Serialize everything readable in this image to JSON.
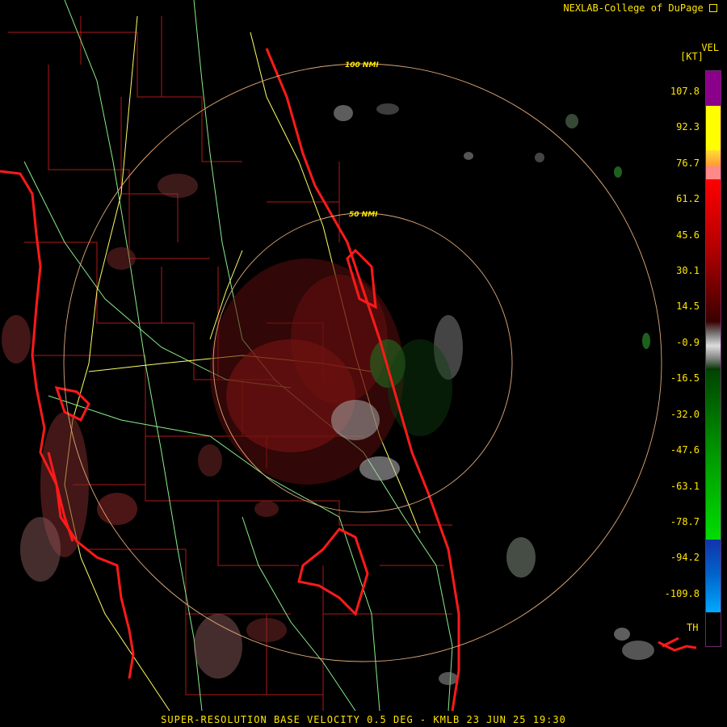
{
  "credit": "NEXLAB-College of DuPage",
  "scale": {
    "product": "VEL",
    "unit": "[KT]",
    "ticks": [
      "107.8",
      "92.3",
      "76.7",
      "61.2",
      "45.6",
      "30.1",
      "14.5",
      "-0.9",
      "-16.5",
      "-32.0",
      "-47.6",
      "-63.1",
      "-78.7",
      "-94.2",
      "-109.8"
    ],
    "th_label": "TH",
    "colors": {
      "purple": "#8b008b",
      "yellow": "#ffff00",
      "orange": "#ff9933",
      "pink": "#ff8888",
      "red": "#ff0000",
      "dark_red": "#4a0000",
      "gray": "#bbbbbb",
      "dark_green": "#004400",
      "green": "#00dd00",
      "blue": "#0066cc",
      "cyan": "#00aaff",
      "black": "#000000"
    }
  },
  "range_rings": {
    "inner_label": "50 NMI",
    "outer_label": "100 NMI",
    "color": "#e0a878"
  },
  "map_colors": {
    "coastline": "#ff1a1a",
    "county_lines": "#b01818",
    "highways": "#ffff66",
    "roads": "#88ee88"
  },
  "product_line": "SUPER-RESOLUTION BASE VELOCITY 0.5 DEG - KMLB 23 JUN 25 19:30"
}
